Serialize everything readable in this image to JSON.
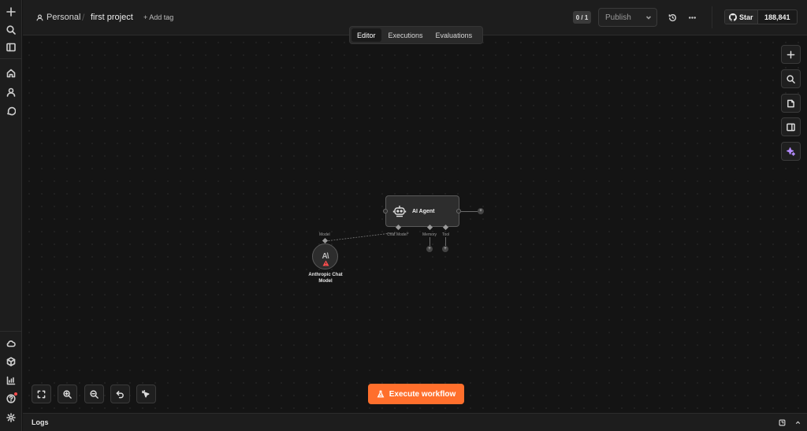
{
  "header": {
    "workspace": "Personal",
    "project": "first project",
    "add_tag": "+ Add tag",
    "counter": "0 / 1",
    "publish_label": "Publish",
    "github_star": "Star",
    "github_count": "188,841"
  },
  "tabs": [
    {
      "label": "Editor",
      "active": true
    },
    {
      "label": "Executions",
      "active": false
    },
    {
      "label": "Evaluations",
      "active": false
    }
  ],
  "canvas": {
    "agent_node": {
      "title": "AI Agent",
      "ports": {
        "chat_model": "Chat Model*",
        "memory": "Memory",
        "tool": "Tool"
      }
    },
    "model_node": {
      "port_label": "Model",
      "logo": "A\\",
      "name": "Anthropic Chat Model"
    }
  },
  "bottom": {
    "execute_label": "Execute workflow"
  },
  "logs": {
    "label": "Logs"
  },
  "colors": {
    "accent": "#ff6f2c",
    "background": "#141414",
    "warning": "#ff4d4d"
  }
}
